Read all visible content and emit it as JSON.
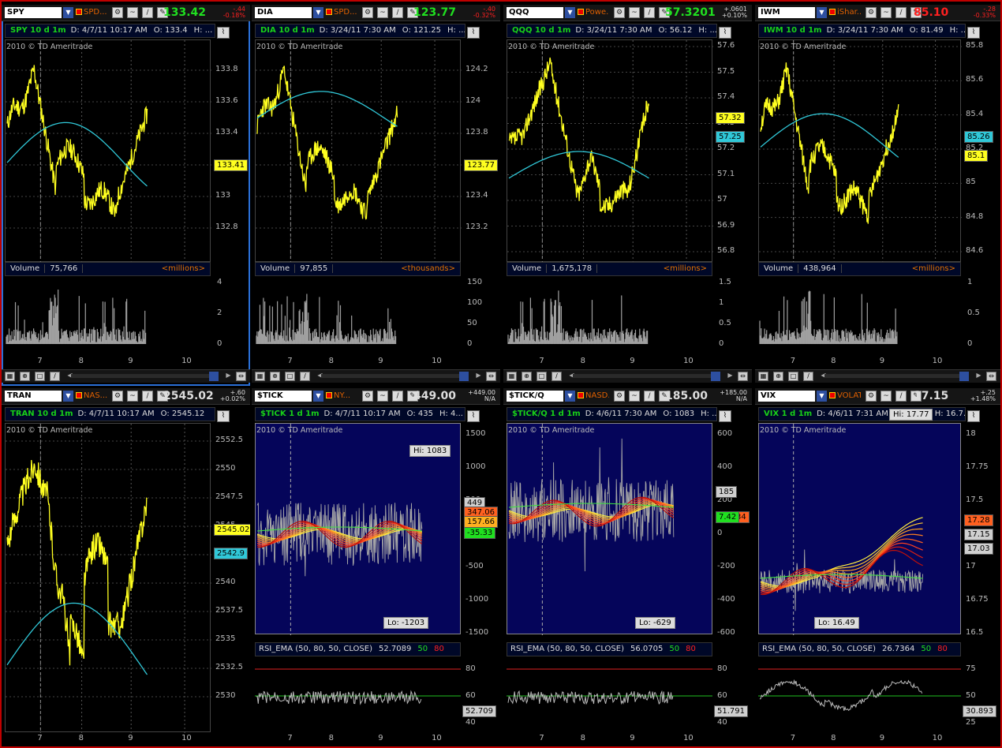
{
  "frame_color": "#c00000",
  "series_colors": {
    "price": "#ffff20",
    "ma": "#30c8d8",
    "volume": "#a0a0a0",
    "up": "#20e020",
    "down": "#ff2020"
  },
  "panels": [
    {
      "symbol": "SPY",
      "desc": "SPD...",
      "last": "133.42",
      "last_color": "#20e020",
      "chg1": "-.44",
      "chg2": "-0.18%",
      "hdr": {
        "title": "SPY 10 d 1m",
        "date": "D: 4/7/11 10:17 AM",
        "open": "O: 133.4",
        "hi": "H: ..."
      },
      "watermark": "2010 © TD Ameritrade",
      "price_scale": [
        "133.8",
        "133.6",
        "133.4",
        "133.2",
        "133",
        "132.8"
      ],
      "badges": [
        {
          "text": "133.41",
          "bg": "#ffff20"
        }
      ],
      "volume": {
        "label": "Volume",
        "value": "75,766",
        "unit": "<millions>",
        "scale": [
          "4",
          "2",
          "0"
        ]
      },
      "x_labels": [
        "7",
        "8",
        "9",
        "10"
      ]
    },
    {
      "symbol": "DIA",
      "desc": "SPD...",
      "last": "123.77",
      "last_color": "#20e020",
      "chg1": "-.40",
      "chg2": "-0.32%",
      "hdr": {
        "title": "DIA 10 d 1m",
        "date": "D: 3/24/11 7:30 AM",
        "open": "O: 121.25",
        "hi": "H: ..."
      },
      "watermark": "2010 © TD Ameritrade",
      "price_scale": [
        "124.2",
        "124",
        "123.8",
        "123.6",
        "123.4",
        "123.2"
      ],
      "badges": [
        {
          "text": "123.77",
          "bg": "#ffff20"
        }
      ],
      "volume": {
        "label": "Volume",
        "value": "97,855",
        "unit": "<thousands>",
        "scale": [
          "150",
          "100",
          "50",
          "0"
        ]
      },
      "x_labels": [
        "7",
        "8",
        "9",
        "10"
      ]
    },
    {
      "symbol": "QQQ",
      "desc": "Powe...",
      "last": "57.3201",
      "last_color": "#20e020",
      "chg1": "+.0601",
      "chg2": "+0.10%",
      "hdr": {
        "title": "QQQ 10 d 1m",
        "date": "D: 3/24/11 7:30 AM",
        "open": "O: 56.12",
        "hi": "H: ..."
      },
      "watermark": "2010 © TD Ameritrade",
      "price_scale": [
        "57.6",
        "57.5",
        "57.4",
        "57.3",
        "57.2",
        "57.1",
        "57",
        "56.9",
        "56.8"
      ],
      "badges": [
        {
          "text": "57.32",
          "bg": "#ffff20"
        },
        {
          "text": "57.25",
          "bg": "#30c8d8"
        }
      ],
      "volume": {
        "label": "Volume",
        "value": "1,675,178",
        "unit": "<millions>",
        "scale": [
          "1.5",
          "1",
          "0.5",
          "0"
        ]
      },
      "x_labels": [
        "7",
        "8",
        "9",
        "10"
      ]
    },
    {
      "symbol": "IWM",
      "desc": "iShar...",
      "last": "85.10",
      "last_color": "#ff2020",
      "chg1": "-.28",
      "chg2": "-0.33%",
      "hdr": {
        "title": "IWM 10 d 1m",
        "date": "D: 3/24/11 7:30 AM",
        "open": "O: 81.49",
        "hi": "H: ..."
      },
      "watermark": "2010 © TD Ameritrade",
      "price_scale": [
        "85.8",
        "85.6",
        "85.4",
        "85.2",
        "85",
        "84.8",
        "84.6"
      ],
      "badges": [
        {
          "text": "85.26",
          "bg": "#30c8d8"
        },
        {
          "text": "85.1",
          "bg": "#ffff20"
        }
      ],
      "volume": {
        "label": "Volume",
        "value": "438,964",
        "unit": "<millions>",
        "scale": [
          "1",
          "0.5",
          "0"
        ]
      },
      "x_labels": [
        "7",
        "8",
        "9",
        "10"
      ]
    },
    {
      "symbol": "TRAN",
      "desc": "NAS...",
      "last": "2545.02",
      "last_color": "#dddddd",
      "chg1": "+.60",
      "chg2": "+0.02%",
      "hdr": {
        "title": "TRAN 10 d 1m",
        "date": "D: 4/7/11 10:17 AM",
        "open": "O: 2545.12",
        "hi": ""
      },
      "watermark": "2010 © TD Ameritrade",
      "price_scale": [
        "2552.5",
        "2550",
        "2547.5",
        "2545",
        "2542.5",
        "2540",
        "2537.5",
        "2535",
        "2532.5",
        "2530"
      ],
      "badges": [
        {
          "text": "2545.02",
          "bg": "#ffff20"
        },
        {
          "text": "2542.9",
          "bg": "#30c8d8"
        }
      ],
      "x_labels": [
        "7",
        "8",
        "9",
        "10"
      ]
    },
    {
      "symbol": "$TICK",
      "desc": "NY...",
      "last": "449.00",
      "last_color": "#dddddd",
      "chg1": "+449.00",
      "chg2": "N/A",
      "hdr": {
        "title": "$TICK 1 d 1m",
        "date": "D: 4/7/11 10:17 AM",
        "open": "O: 435",
        "hi": "H: 4..."
      },
      "watermark": "2010 © TD Ameritrade",
      "price_scale": [
        "1500",
        "1000",
        "500",
        "0",
        "-500",
        "-1000",
        "-1500"
      ],
      "badges": [
        {
          "text": "449",
          "bg": "#cfcfcf"
        },
        {
          "text": "347.06",
          "bg": "#ff6020"
        },
        {
          "text": "157.66",
          "bg": "#ffb020"
        },
        {
          "text": "-35.33",
          "bg": "#20e020"
        }
      ],
      "callouts": {
        "hi": "Hi: 1083",
        "lo": "Lo: -1203"
      },
      "rsi": {
        "name": "RSI_EMA (50, 80, 50, CLOSE)",
        "value": "52.7089",
        "lo": "50",
        "hi": "80",
        "scale": [
          "80",
          "60",
          "40"
        ],
        "badge": "52.709"
      },
      "x_labels": [
        "7",
        "8",
        "9",
        "10"
      ]
    },
    {
      "symbol": "$TICK/Q",
      "desc": "NASD...",
      "last": "185.00",
      "last_color": "#dddddd",
      "chg1": "+185.00",
      "chg2": "N/A",
      "hdr": {
        "title": "$TICK/Q 1 d 1m",
        "date": "D: 4/6/11 7:30 AM",
        "open": "O: 1083",
        "hi": "H: ..."
      },
      "watermark": "2010 © TD Ameritrade",
      "price_scale": [
        "600",
        "400",
        "200",
        "0",
        "-200",
        "-400",
        "-600"
      ],
      "badges": [
        {
          "text": "185",
          "bg": "#cfcfcf"
        },
        {
          "text": "34",
          "bg": "#ff6020"
        },
        {
          "text": "7.42",
          "bg": "#20e020"
        }
      ],
      "callouts": {
        "hi": "",
        "lo": "Lo: -629"
      },
      "rsi": {
        "name": "RSI_EMA (50, 80, 50, CLOSE)",
        "value": "56.0705",
        "lo": "50",
        "hi": "80",
        "scale": [
          "80",
          "60",
          "40"
        ],
        "badge": "51.791"
      },
      "x_labels": [
        "7",
        "8",
        "9",
        "10"
      ]
    },
    {
      "symbol": "VIX",
      "desc": "VOLATIL...",
      "last": "17.15",
      "last_color": "#dddddd",
      "chg1": "+.25",
      "chg2": "+1.48%",
      "hdr": {
        "title": "VIX 1 d 1m",
        "date": "D: 4/6/11 7:31 AM",
        "open": "O: 16.75",
        "hi": "H: 16.7..."
      },
      "watermark": "2010 © TD Ameritrade",
      "price_scale": [
        "18",
        "17.75",
        "17.5",
        "17.25",
        "17",
        "16.75",
        "16.5"
      ],
      "badges": [
        {
          "text": "17.28",
          "bg": "#ff6020"
        },
        {
          "text": "17.15",
          "bg": "#cfcfcf"
        },
        {
          "text": "17.03",
          "bg": "#cfcfcf"
        }
      ],
      "callouts": {
        "hi": "Hi: 17.77",
        "lo": "Lo: 16.49"
      },
      "rsi": {
        "name": "RSI_EMA (50, 80, 50, CLOSE)",
        "value": "26.7364",
        "lo": "50",
        "hi": "80",
        "scale": [
          "75",
          "50",
          "25"
        ],
        "badge": "30.893"
      },
      "x_labels": [
        "7",
        "8",
        "9",
        "10"
      ]
    }
  ]
}
